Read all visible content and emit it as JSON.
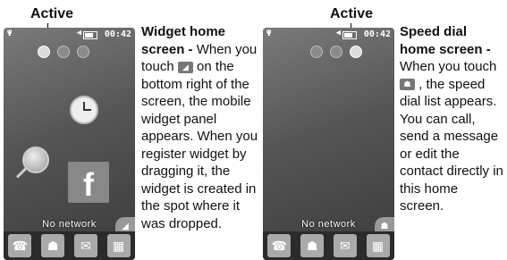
{
  "left": {
    "active_label": "Active",
    "phone": {
      "time": "00:42",
      "status_text": "No network",
      "widgets": [
        "clock-icon",
        "search-icon",
        "facebook-icon"
      ],
      "fb_letter": "f"
    },
    "text": {
      "title": "Widget home screen -",
      "p1": "When you touch",
      "p2": "on the bottom right of the screen, the mobile widget panel appears. When you register widget by dragging it, the widget is created in the spot where it was dropped."
    }
  },
  "right": {
    "active_label": "Active",
    "phone": {
      "time": "00:42",
      "status_text": "No network"
    },
    "text": {
      "title": "Speed dial home screen -",
      "p1": "When you touch",
      "p2": ", the speed dial list appears. You can call, send a message or edit the contact directly in this home screen."
    }
  },
  "dock_icons": [
    "phone-icon",
    "contacts-icon",
    "message-icon",
    "menu-icon"
  ],
  "colors": {
    "phone_bg": "#555555",
    "dock_bg": "#2b2b2b",
    "text": "#111111"
  }
}
